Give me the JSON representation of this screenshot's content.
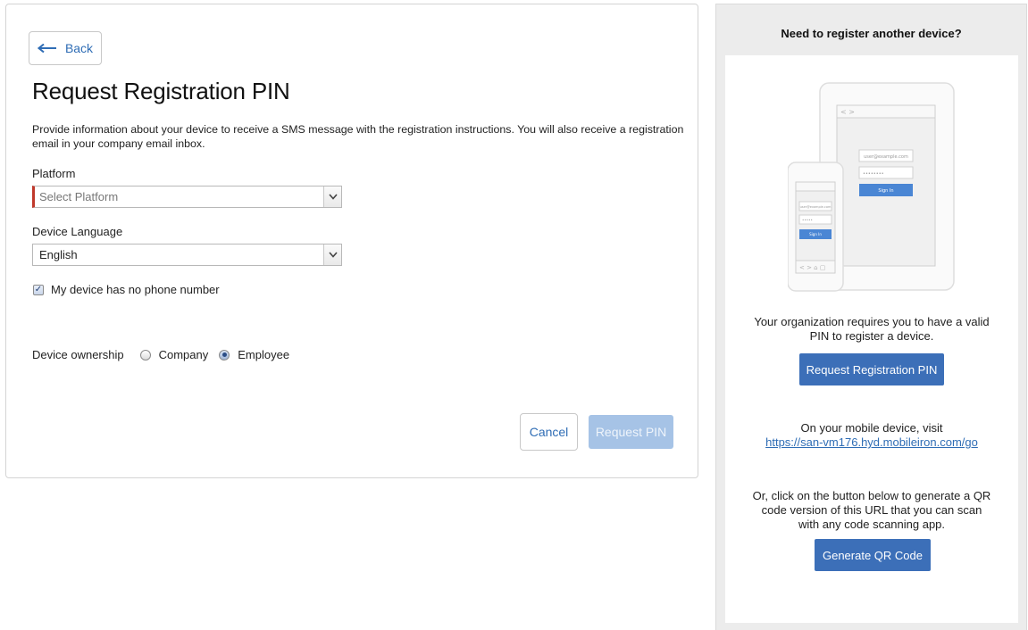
{
  "form": {
    "back_label": "Back",
    "title": "Request Registration PIN",
    "intro": "Provide information about your device to receive a SMS message with the registration instructions. You will also receive a registration email in your company email inbox.",
    "platform_label": "Platform",
    "platform_value": "Select Platform",
    "language_label": "Device Language",
    "language_value": "English",
    "no_phone_label": "My device has no phone number",
    "no_phone_checked": true,
    "ownership_label": "Device ownership",
    "ownership_options": [
      {
        "label": "Company",
        "checked": false
      },
      {
        "label": "Employee",
        "checked": true
      }
    ],
    "cancel_label": "Cancel",
    "request_pin_label": "Request PIN"
  },
  "side": {
    "title": "Need to register another device?",
    "illustration": {
      "tablet_email": "user@example.com",
      "tablet_password": "••••••••",
      "tablet_signin": "Sign In",
      "phone_email": "user@example.com",
      "phone_password": "•••••",
      "phone_signin": "Sign In"
    },
    "pin_text_line1": "Your organization requires you to have a valid",
    "pin_text_line2": "PIN to register a device.",
    "request_button": "Request Registration PIN",
    "visit_text": "On your mobile device, visit",
    "visit_url": "https://san-vm176.hyd.mobileiron.com/go",
    "qr_text_line1": "Or, click on the button below to generate a QR",
    "qr_text_line2": "code version of this URL that you can scan",
    "qr_text_line3": "with any code scanning app.",
    "qr_button": "Generate QR Code"
  },
  "colors": {
    "link": "#2f6db5",
    "primary_button": "#3c6fb8",
    "disabled_button": "#a6c3e6",
    "error_border": "#c0392b"
  }
}
